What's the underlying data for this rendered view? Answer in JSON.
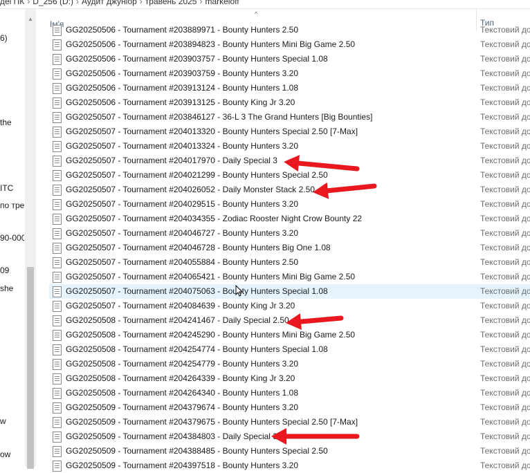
{
  "breadcrumb": [
    "деі ПК",
    "D_256 (D:)",
    "Аудит джуніор",
    "травень 2025",
    "markeloff"
  ],
  "nav_fragments": [
    "6)",
    "the",
    "ITC",
    "по трен",
    "90-000",
    "09",
    "she",
    "w",
    "ow"
  ],
  "columns": {
    "name": "Ім'я",
    "type": "Тип"
  },
  "files": [
    {
      "name": "GG20250506 - Tournament #203889971 - Bounty Hunters 2.50",
      "type": "Текстовий до"
    },
    {
      "name": "GG20250506 - Tournament #203894823 - Bounty Hunters Mini Big Game 2.50",
      "type": "Текстовий до"
    },
    {
      "name": "GG20250506 - Tournament #203903757 - Bounty Hunters Special 1.08",
      "type": "Текстовий до"
    },
    {
      "name": "GG20250506 - Tournament #203903759 - Bounty Hunters 3.20",
      "type": "Текстовий до"
    },
    {
      "name": "GG20250506 - Tournament #203913124 - Bounty Hunters 1.08",
      "type": "Текстовий до"
    },
    {
      "name": "GG20250506 - Tournament #203913125 - Bounty King Jr 3.20",
      "type": "Текстовий до"
    },
    {
      "name": "GG20250507 - Tournament #203846127 - 36-L 3 The Grand Hunters [Big Bounties]",
      "type": "Текстовий до"
    },
    {
      "name": "GG20250507 - Tournament #204013320 - Bounty Hunters Special 2.50 [7-Max]",
      "type": "Текстовий до"
    },
    {
      "name": "GG20250507 - Tournament #204013324 - Bounty Hunters 3.20",
      "type": "Текстовий до"
    },
    {
      "name": "GG20250507 - Tournament #204017970 - Daily Special 3",
      "type": "Текстовий до"
    },
    {
      "name": "GG20250507 - Tournament #204021299 - Bounty Hunters Special 2.50",
      "type": "Текстовий до"
    },
    {
      "name": "GG20250507 - Tournament #204026052 - Daily Monster Stack 2.50",
      "type": "Текстовий до"
    },
    {
      "name": "GG20250507 - Tournament #204029515 - Bounty Hunters 3.20",
      "type": "Текстовий до"
    },
    {
      "name": "GG20250507 - Tournament #204034355 - Zodiac Rooster Night Crow Bounty 22",
      "type": "Текстовий до"
    },
    {
      "name": "GG20250507 - Tournament #204046727 - Bounty Hunters 3.20",
      "type": "Текстовий до"
    },
    {
      "name": "GG20250507 - Tournament #204046728 - Bounty Hunters Big One 1.08",
      "type": "Текстовий до"
    },
    {
      "name": "GG20250507 - Tournament #204055884 - Bounty Hunters 2.50",
      "type": "Текстовий до"
    },
    {
      "name": "GG20250507 - Tournament #204065421 - Bounty Hunters Mini Big Game 2.50",
      "type": "Текстовий до"
    },
    {
      "name": "GG20250507 - Tournament #204075063 - Bounty Hunters Special 1.08",
      "type": "Текстовий до"
    },
    {
      "name": "GG20250507 - Tournament #204084639 - Bounty King Jr 3.20",
      "type": "Текстовий до"
    },
    {
      "name": "GG20250508 - Tournament #204241467 - Daily Special 2.50",
      "type": "Текстовий до"
    },
    {
      "name": "GG20250508 - Tournament #204245290 - Bounty Hunters Mini Big Game 2.50",
      "type": "Текстовий до"
    },
    {
      "name": "GG20250508 - Tournament #204254774 - Bounty Hunters Special 1.08",
      "type": "Текстовий до"
    },
    {
      "name": "GG20250508 - Tournament #204254779 - Bounty Hunters 3.20",
      "type": "Текстовий до"
    },
    {
      "name": "GG20250508 - Tournament #204264339 - Bounty King Jr 3.20",
      "type": "Текстовий до"
    },
    {
      "name": "GG20250508 - Tournament #204264340 - Bounty Hunters 1.08",
      "type": "Текстовий до"
    },
    {
      "name": "GG20250509 - Tournament #204379674 - Bounty Hunters 3.20",
      "type": "Текстовий до"
    },
    {
      "name": "GG20250509 - Tournament #204379675 - Bounty Hunters Special 2.50 [7-Max]",
      "type": "Текстовий до"
    },
    {
      "name": "GG20250509 - Tournament #204384803 - Daily Special 3",
      "type": "Текстовий до"
    },
    {
      "name": "GG20250509 - Tournament #204388485 - Bounty Hunters Special 2.50",
      "type": "Текстовий до"
    },
    {
      "name": "GG20250509 - Tournament #204397518 - Bounty Hunters 3.20",
      "type": "Текстовий до"
    }
  ],
  "selected_row": 18,
  "arrow_color": "#e8181e",
  "highlighted_rows": [
    9,
    11,
    20,
    28
  ]
}
